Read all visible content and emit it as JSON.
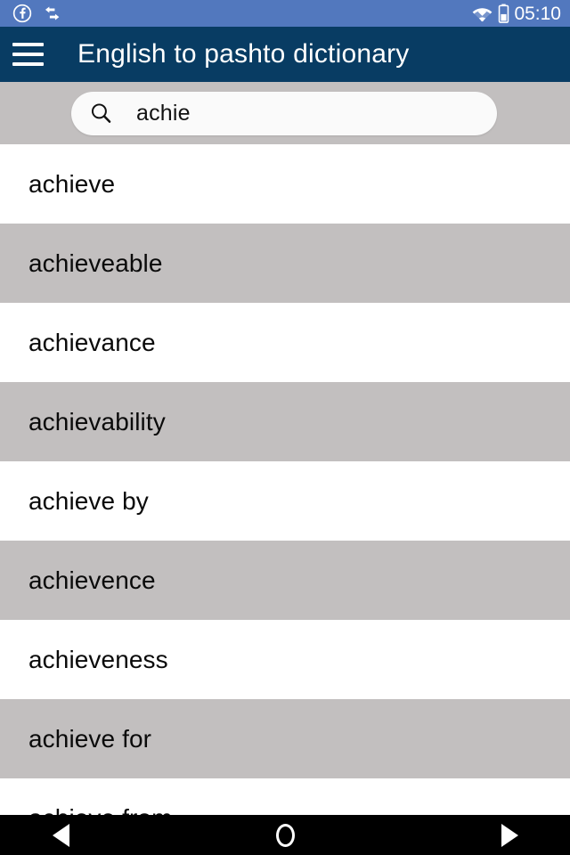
{
  "status_bar": {
    "left_icons": [
      {
        "name": "facebook-icon",
        "label": "Facebook notification"
      },
      {
        "name": "data-sync-icon",
        "label": "Data transfer"
      }
    ],
    "right_icons": [
      {
        "name": "wifi-icon",
        "label": "Wi-Fi"
      },
      {
        "name": "battery-icon",
        "label": "Battery"
      }
    ],
    "time": "05:10",
    "background_color": "#5278be",
    "foreground_color": "#ffffff"
  },
  "app_bar": {
    "menu_icon": "hamburger-menu-icon",
    "title": "English to pashto dictionary",
    "background_color": "#083c63",
    "text_color": "#ffffff"
  },
  "search": {
    "icon": "search-icon",
    "value": "achie",
    "placeholder": "Search",
    "strip_color": "#c2bfbf",
    "field_color": "#fafafa"
  },
  "results": {
    "row_color_odd": "#ffffff",
    "row_color_even": "#c2bfbf",
    "items": [
      {
        "word": "achieve"
      },
      {
        "word": "achieveable"
      },
      {
        "word": "achievance"
      },
      {
        "word": "achievability"
      },
      {
        "word": "achieve by"
      },
      {
        "word": "achievence"
      },
      {
        "word": "achieveness"
      },
      {
        "word": "achieve for"
      },
      {
        "word": "achieve from"
      }
    ]
  },
  "nav_bar": {
    "background_color": "#000000",
    "buttons": [
      {
        "name": "back-button",
        "icon": "triangle-left-icon",
        "label": "Back"
      },
      {
        "name": "home-button",
        "icon": "circle-icon",
        "label": "Home"
      },
      {
        "name": "recents-button",
        "icon": "triangle-right-icon",
        "label": "Recents"
      }
    ]
  }
}
